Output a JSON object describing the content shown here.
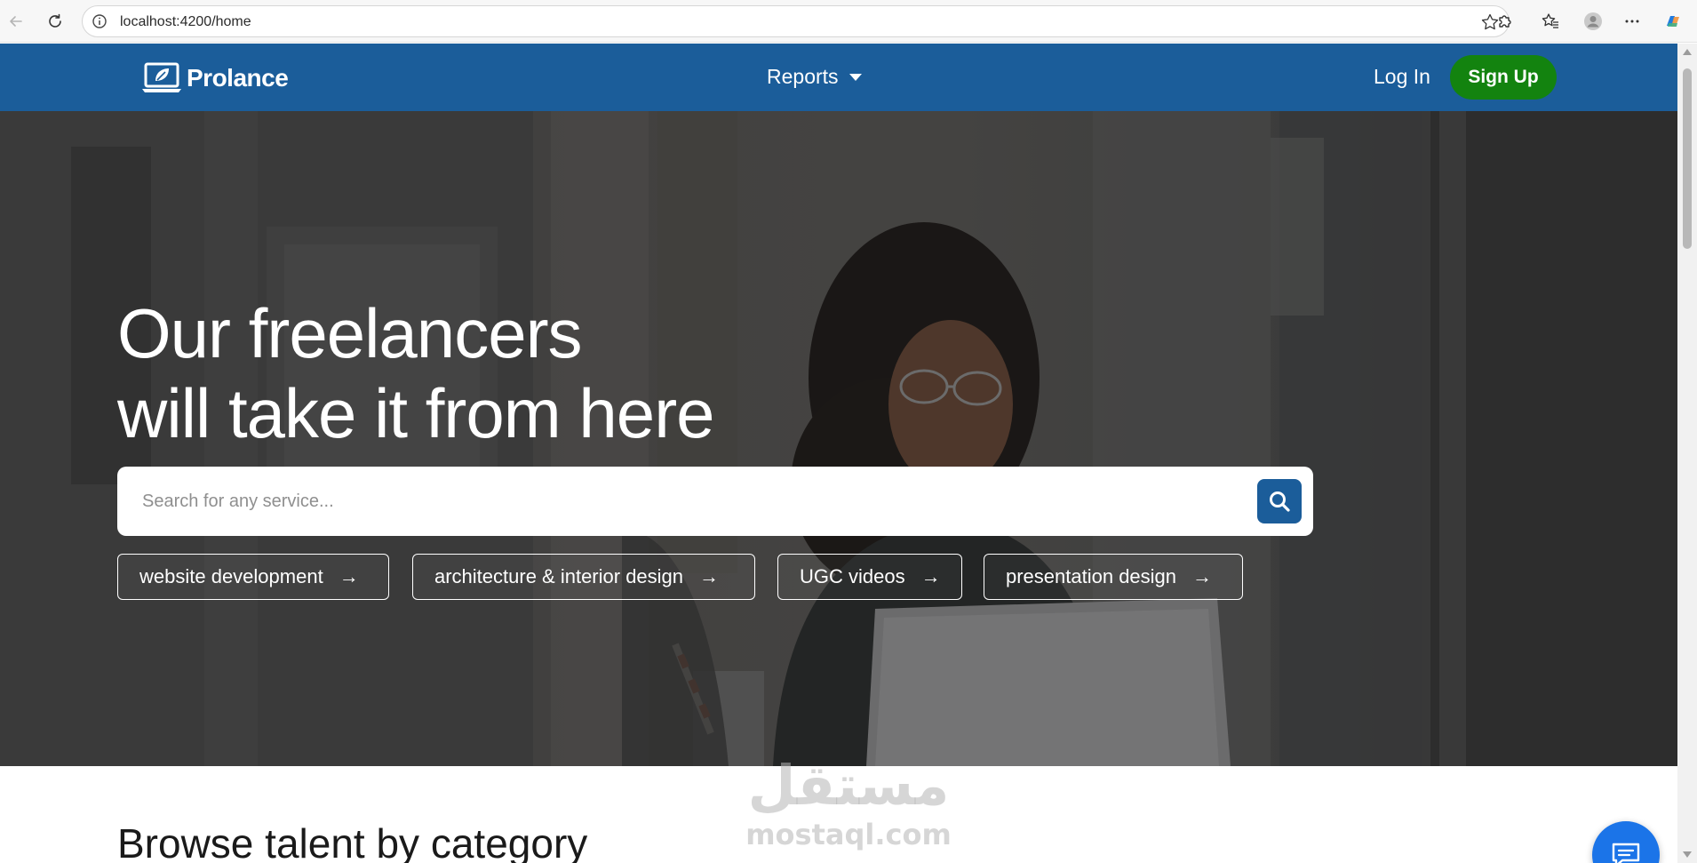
{
  "browser": {
    "url": "localhost:4200/home"
  },
  "navbar": {
    "brand": "Prolance",
    "reports_label": "Reports",
    "login_label": "Log In",
    "signup_label": "Sign Up"
  },
  "hero": {
    "title_line1": "Our freelancers",
    "title_line2": "will take it from here",
    "search_placeholder": "Search for any service...",
    "chips": [
      {
        "label": "website development",
        "arrow": "→"
      },
      {
        "label": "architecture & interior design",
        "arrow": "→"
      },
      {
        "label": "UGC videos",
        "arrow": "→"
      },
      {
        "label": "presentation design",
        "arrow": "→"
      }
    ]
  },
  "browse": {
    "title": "Browse talent by category"
  },
  "watermark": {
    "arabic": "مستقل",
    "english": "mostaql.com"
  },
  "colors": {
    "navbar": "#1b5d9a",
    "signup": "#13830f",
    "search_button": "#1b5d9a",
    "chat_fab": "#1b74e8"
  }
}
